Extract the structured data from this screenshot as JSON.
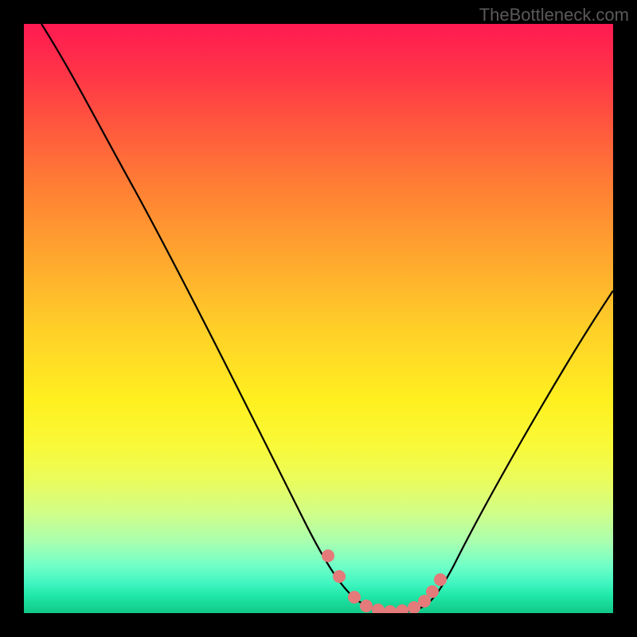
{
  "watermark": "TheBottleneck.com",
  "chart_data": {
    "type": "line",
    "title": "",
    "xlabel": "",
    "ylabel": "",
    "xlim": [
      0,
      100
    ],
    "ylim": [
      0,
      100
    ],
    "series": [
      {
        "name": "bottleneck-curve",
        "x": [
          3,
          10,
          20,
          30,
          40,
          48,
          52,
          55,
          58,
          60,
          62,
          64,
          66,
          68,
          70,
          75,
          85,
          95,
          100
        ],
        "y": [
          100,
          90,
          74,
          56,
          38,
          20,
          10,
          5,
          2,
          1,
          0.5,
          0.5,
          0.5,
          1,
          3,
          10,
          28,
          45,
          53
        ]
      }
    ],
    "markers": {
      "name": "highlight-dots",
      "color": "#e47a7a",
      "points": [
        {
          "x": 52,
          "y": 10
        },
        {
          "x": 54,
          "y": 6
        },
        {
          "x": 57,
          "y": 2.5
        },
        {
          "x": 59,
          "y": 1.2
        },
        {
          "x": 61,
          "y": 0.8
        },
        {
          "x": 63,
          "y": 0.6
        },
        {
          "x": 65,
          "y": 0.8
        },
        {
          "x": 67,
          "y": 1.5
        },
        {
          "x": 68.5,
          "y": 3
        },
        {
          "x": 69.5,
          "y": 4.5
        },
        {
          "x": 70.5,
          "y": 6.5
        }
      ]
    },
    "gradient_stops": [
      {
        "pos": 0,
        "color": "#ff1a52"
      },
      {
        "pos": 50,
        "color": "#ffd028"
      },
      {
        "pos": 100,
        "color": "#12c888"
      }
    ]
  }
}
